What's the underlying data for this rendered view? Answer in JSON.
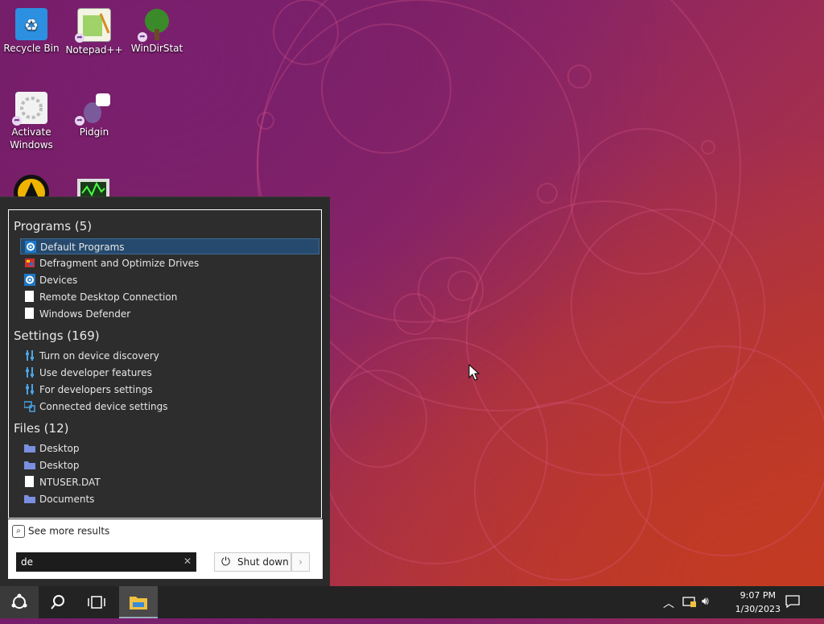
{
  "desktop": {
    "icons": [
      {
        "label": "Recycle Bin",
        "icon": "recycle-bin-icon"
      },
      {
        "label": "Notepad++",
        "icon": "notepad-plus-plus-icon"
      },
      {
        "label": "WinDirStat",
        "icon": "windirstat-icon"
      },
      {
        "label": "Activate Windows",
        "icon": "activate-windows-icon"
      },
      {
        "label": "Pidgin",
        "icon": "pidgin-icon"
      }
    ]
  },
  "start_menu": {
    "categories": {
      "programs": "Programs (5)",
      "settings": "Settings (169)",
      "files": "Files (12)"
    },
    "programs": [
      {
        "label": "Default Programs",
        "icon": "gear-icon",
        "selected": true
      },
      {
        "label": "Defragment and Optimize Drives",
        "icon": "defrag-icon"
      },
      {
        "label": "Devices",
        "icon": "gear-icon"
      },
      {
        "label": "Remote Desktop Connection",
        "icon": "blank-file-icon"
      },
      {
        "label": "Windows Defender",
        "icon": "blank-file-icon"
      }
    ],
    "settings": [
      {
        "label": "Turn on device discovery",
        "icon": "settings-sliders-icon"
      },
      {
        "label": "Use developer features",
        "icon": "settings-sliders-icon"
      },
      {
        "label": "For developers settings",
        "icon": "settings-sliders-icon"
      },
      {
        "label": "Connected device settings",
        "icon": "connected-devices-icon"
      }
    ],
    "files": [
      {
        "label": "Desktop",
        "icon": "folder-icon"
      },
      {
        "label": "Desktop",
        "icon": "folder-icon"
      },
      {
        "label": "NTUSER.DAT",
        "icon": "blank-file-icon"
      },
      {
        "label": "Documents",
        "icon": "folder-icon"
      }
    ],
    "see_more": "See more results",
    "search_value": "de",
    "shutdown_label": "Shut down"
  },
  "taskbar": {
    "time": "9:07 PM",
    "date": "1/30/2023"
  },
  "colors": {
    "selection": "#264a6e",
    "menu_bg": "#2b2b2b",
    "taskbar_bg": "#232323"
  }
}
